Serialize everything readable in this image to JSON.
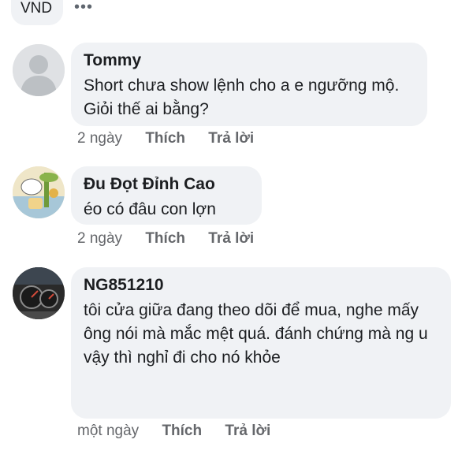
{
  "top": {
    "currency": "VND",
    "more": "•••"
  },
  "comments": [
    {
      "author": "Tommy",
      "text": "Short chưa show lệnh cho a e ngưỡng mộ. Giỏi thế ai bằng?",
      "time": "2 ngày",
      "like": "Thích",
      "reply": "Trả lời"
    },
    {
      "author": "Đu Đọt Đỉnh Cao",
      "text": "éo có đâu con lợn",
      "time": "2 ngày",
      "like": "Thích",
      "reply": "Trả lời"
    },
    {
      "author": "NG851210",
      "text": "tôi cửa giữa đang theo dõi để mua, nghe mấy ông nói mà mắc mệt quá. đánh chứng mà ng u vậy thì nghỉ đi cho nó khỏe",
      "time": "một ngày",
      "like": "Thích",
      "reply": "Trả lời"
    }
  ]
}
